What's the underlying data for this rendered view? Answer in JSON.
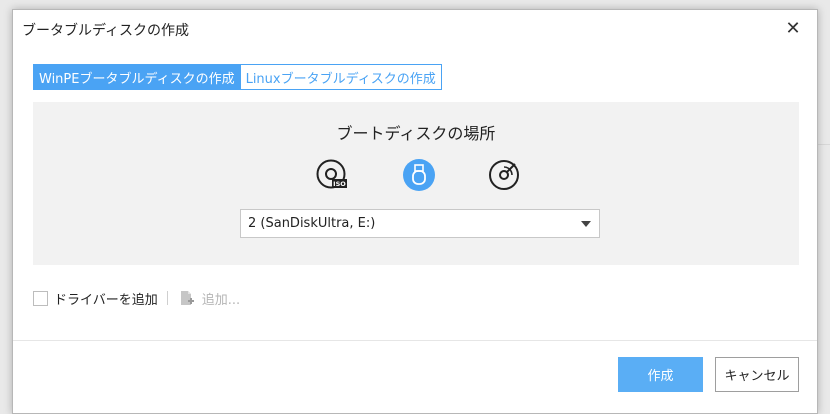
{
  "dialog": {
    "title": "ブータブルディスクの作成",
    "close_glyph": "✕"
  },
  "tabs": [
    {
      "label": "WinPEブータブルディスクの作成",
      "active": true
    },
    {
      "label": "Linuxブータブルディスクの作成",
      "active": false
    }
  ],
  "panel": {
    "title": "ブートディスクの場所",
    "media_options": [
      {
        "name": "iso-icon",
        "selected": false,
        "badge": "ISO"
      },
      {
        "name": "usb-icon",
        "selected": true
      },
      {
        "name": "cd-icon",
        "selected": false
      }
    ],
    "device": {
      "selected": "2 (SanDiskUltra, E:)"
    }
  },
  "driver": {
    "checkbox_checked": false,
    "label": "ドライバーを追加",
    "add_label": "追加..."
  },
  "buttons": {
    "create": "作成",
    "cancel": "キャンセル"
  },
  "colors": {
    "accent": "#4aa3f4",
    "button_primary": "#5aaef5",
    "panel_bg": "#f2f2f2"
  }
}
